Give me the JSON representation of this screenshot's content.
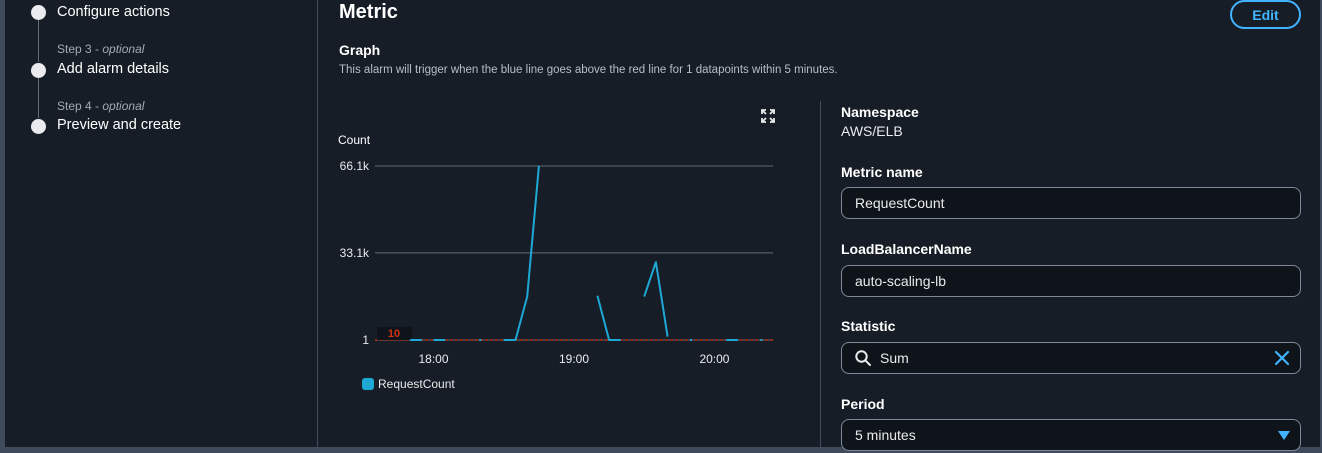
{
  "steps": [
    {
      "title": "Configure actions"
    },
    {
      "step_label": "Step 3",
      "optional": "optional",
      "title": "Add alarm details"
    },
    {
      "step_label": "Step 4",
      "optional": "optional",
      "title": "Preview and create"
    }
  ],
  "panel": {
    "title": "Metric",
    "edit_label": "Edit",
    "graph_title": "Graph",
    "graph_description": "This alarm will trigger when the blue line goes above the red line for 1 datapoints within 5 minutes."
  },
  "chart_data": {
    "type": "line",
    "ylabel": "Count",
    "y_ticks": [
      "66.1k",
      "33.1k",
      "1"
    ],
    "y_tick_values": [
      66100,
      33100,
      1
    ],
    "ylim": [
      1,
      66100
    ],
    "x_ticks": [
      "18:00",
      "19:00",
      "20:00"
    ],
    "xlim": [
      "17:35",
      "20:25"
    ],
    "threshold": {
      "value": 10,
      "label": "10",
      "color": "#d13212"
    },
    "series": [
      {
        "name": "RequestCount",
        "color": "#1ea8d6",
        "segments": [
          [
            [
              "17:50",
              1
            ],
            [
              "17:55",
              1
            ]
          ],
          [
            [
              "18:00",
              1
            ],
            [
              "18:05",
              1
            ]
          ],
          [
            [
              "18:20",
              1
            ]
          ],
          [
            [
              "18:30",
              1
            ],
            [
              "18:35",
              1
            ],
            [
              "18:40",
              16500
            ],
            [
              "18:45",
              66100
            ]
          ],
          [
            [
              "19:10",
              16800
            ],
            [
              "19:15",
              1
            ],
            [
              "19:20",
              1
            ]
          ],
          [
            [
              "19:30",
              16500
            ],
            [
              "19:35",
              29600
            ],
            [
              "19:40",
              1300
            ]
          ],
          [
            [
              "19:50",
              1
            ]
          ],
          [
            [
              "20:05",
              1
            ],
            [
              "20:10",
              1
            ]
          ],
          [
            [
              "20:20",
              1
            ]
          ]
        ]
      }
    ],
    "legend": [
      "RequestCount"
    ],
    "grid": true
  },
  "fields": {
    "namespace_label": "Namespace",
    "namespace_value": "AWS/ELB",
    "metric_name_label": "Metric name",
    "metric_name_value": "RequestCount",
    "lb_label": "LoadBalancerName",
    "lb_value": "auto-scaling-lb",
    "statistic_label": "Statistic",
    "statistic_value": "Sum",
    "period_label": "Period",
    "period_value": "5 minutes"
  },
  "icons": {
    "expand": "expand-icon",
    "search": "search-icon",
    "clear": "close-icon",
    "caret": "caret-down-icon"
  },
  "colors": {
    "accent": "#42b4ff",
    "series": "#1ea8d6",
    "threshold": "#d13212",
    "background": "#161d26"
  }
}
